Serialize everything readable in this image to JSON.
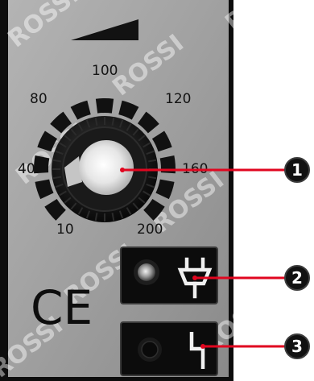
{
  "panel": {
    "dial_scale": [
      "10",
      "40",
      "80",
      "100",
      "120",
      "160",
      "200"
    ],
    "ce_mark": "CE",
    "watermark": "ROSSI"
  },
  "callouts": [
    "1",
    "2",
    "3"
  ],
  "icons": {
    "power_indicator": "plug-icon",
    "fault_indicator": "fault-icon",
    "power_ramp": "ramp-triangle-icon"
  },
  "colors": {
    "panel": "#9d9d9d",
    "frame": "#0d0d0d",
    "leader": "#e0061f",
    "badge": "#111111"
  }
}
